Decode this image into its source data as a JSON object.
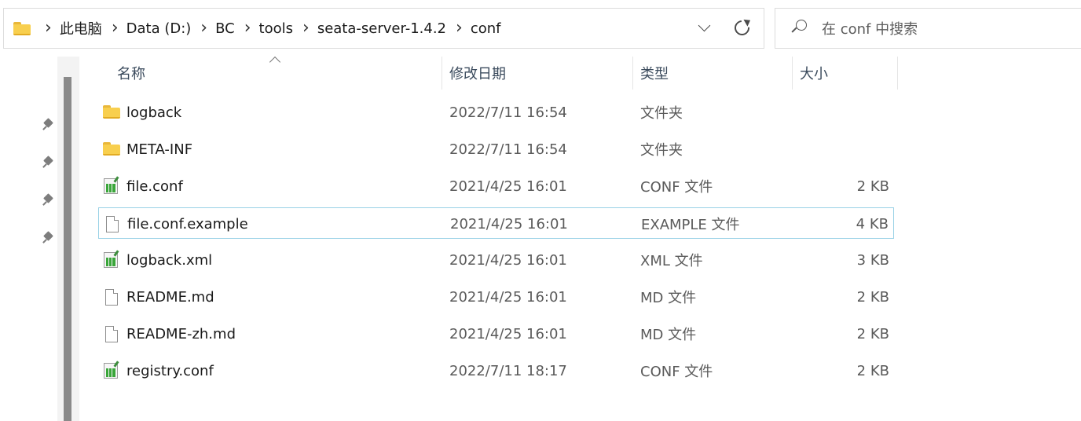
{
  "breadcrumb": [
    "此电脑",
    "Data (D:)",
    "BC",
    "tools",
    "seata-server-1.4.2",
    "conf"
  ],
  "search": {
    "placeholder": "在 conf 中搜索"
  },
  "columns": {
    "name": "名称",
    "date": "修改日期",
    "type": "类型",
    "size": "大小"
  },
  "files": [
    {
      "name": "logback",
      "date": "2022/7/11 16:54",
      "type": "文件夹",
      "size": "",
      "icon": "folder-icon"
    },
    {
      "name": "META-INF",
      "date": "2022/7/11 16:54",
      "type": "文件夹",
      "size": "",
      "icon": "folder-icon"
    },
    {
      "name": "file.conf",
      "date": "2021/4/25 16:01",
      "type": "CONF 文件",
      "size": "2 KB",
      "icon": "conf-file-icon"
    },
    {
      "name": "file.conf.example",
      "date": "2021/4/25 16:01",
      "type": "EXAMPLE 文件",
      "size": "4 KB",
      "icon": "blank-file-icon",
      "selected": true
    },
    {
      "name": "logback.xml",
      "date": "2021/4/25 16:01",
      "type": "XML 文件",
      "size": "3 KB",
      "icon": "conf-file-icon"
    },
    {
      "name": "README.md",
      "date": "2021/4/25 16:01",
      "type": "MD 文件",
      "size": "2 KB",
      "icon": "blank-file-icon"
    },
    {
      "name": "README-zh.md",
      "date": "2021/4/25 16:01",
      "type": "MD 文件",
      "size": "2 KB",
      "icon": "blank-file-icon"
    },
    {
      "name": "registry.conf",
      "date": "2022/7/11 18:17",
      "type": "CONF 文件",
      "size": "2 KB",
      "icon": "conf-file-icon"
    }
  ]
}
